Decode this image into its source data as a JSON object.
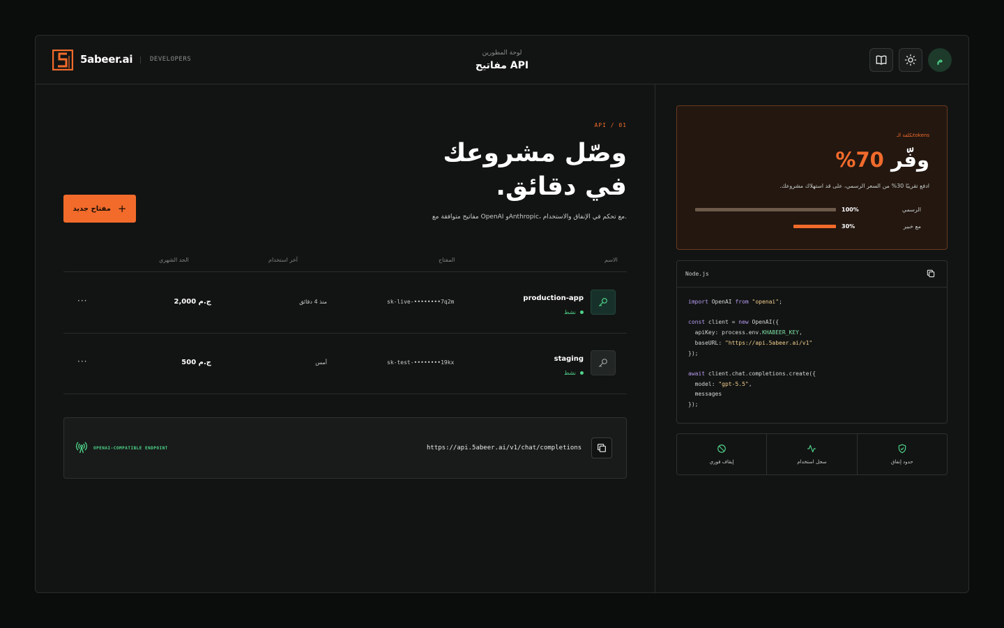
{
  "header": {
    "brand": "5abeer.ai",
    "section": "DEVELOPERS",
    "subtitle": "لوحة المطورين",
    "title": "مفاتيح API",
    "avatar_initial": "م",
    "icons": [
      "book-icon",
      "sun-icon"
    ]
  },
  "hero": {
    "tag": "API / 01",
    "title_line1": "وصّل مشروعك",
    "title_line2": "في دقائق.",
    "description": "مفاتيح متوافقة مع OpenAI وAnthropic، مع تحكم في الإنفاق والاستخدام."
  },
  "new_key_button": "مفتاح جديد",
  "table": {
    "columns": {
      "name": "الاسم",
      "key": "المفتاح",
      "last_used": "آخر استخدام",
      "limit": "الحد الشهري"
    },
    "rows": [
      {
        "name": "production-app",
        "status": "نشط",
        "key": "sk-live-••••••••7q2m",
        "last_used": "منذ 4 دقائق",
        "limit": "2,000 ج.م",
        "more": "···",
        "icon": "key-icon",
        "accent": "#4fd38a"
      },
      {
        "name": "staging",
        "status": "نشط",
        "key": "sk-test-••••••••19kx",
        "last_used": "أمس",
        "limit": "500 ج.م",
        "more": "···",
        "icon": "key-icon",
        "accent": "#9aa09c"
      }
    ]
  },
  "endpoint": {
    "label": "OPENAI-COMPATIBLE ENDPOINT",
    "url": "https://api.5abeer.ai/v1/chat/completions"
  },
  "savings": {
    "label": "تكلفة الـtokens",
    "headline_word": "وفّر",
    "headline_pct": "70%",
    "description": "ادفع تقريبًا 30% من السعر الرسمي، على قد استهلاك مشروعك.",
    "bars": [
      {
        "label": "الرسمي",
        "percent_text": "100%",
        "value": 1.0,
        "color": "#6e5a4a"
      },
      {
        "label": "مع خبير",
        "percent_text": "30%",
        "value": 0.3,
        "color": "#f26b2b"
      }
    ]
  },
  "code": {
    "language": "Node.js",
    "lines": [
      "import OpenAI from \"openai\";",
      "",
      "const client = new OpenAI({",
      "  apiKey: process.env.KHABEER_KEY,",
      "  baseURL: \"https://api.5abeer.ai/v1\"",
      "});",
      "",
      "await client.chat.completions.create({",
      "  model: \"gpt-5.5\",",
      "  messages",
      "});"
    ]
  },
  "features": [
    {
      "label": "إيقاف فوري",
      "icon": "ban-icon"
    },
    {
      "label": "سجل استخدام",
      "icon": "activity-icon"
    },
    {
      "label": "حدود إنفاق",
      "icon": "shield-check-icon"
    }
  ],
  "colors": {
    "accent": "#f26b2b",
    "success": "#4fd38a",
    "background": "#121413"
  }
}
